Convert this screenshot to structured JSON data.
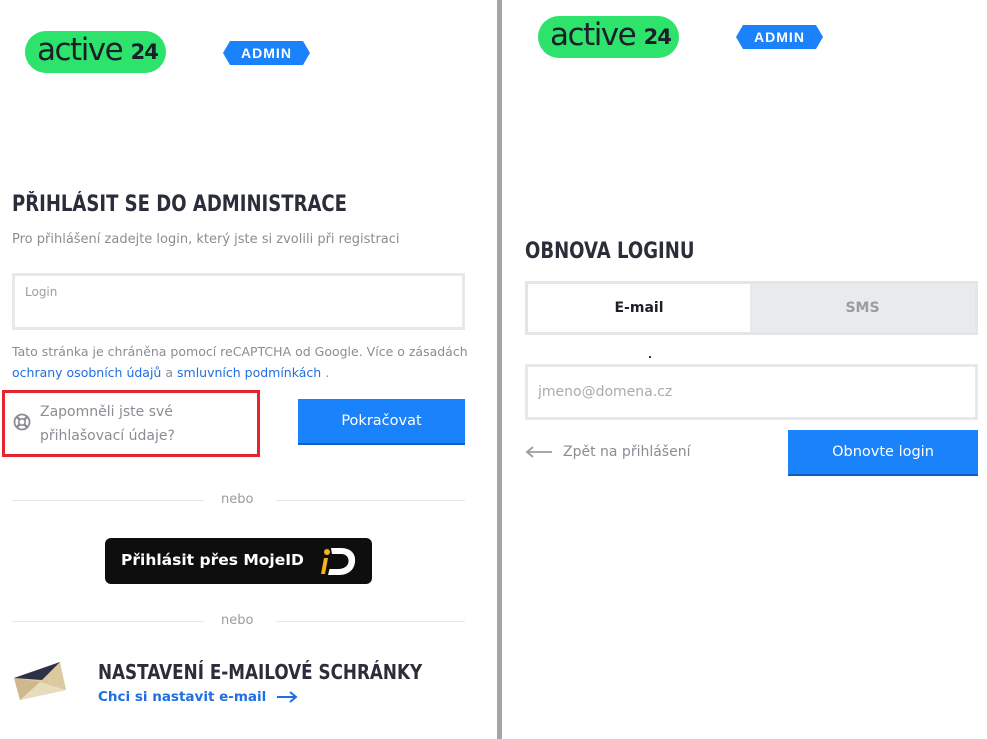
{
  "colors": {
    "brand_green": "#2de36b",
    "brand_blue": "#1a82fb",
    "highlight_red": "#e3262d",
    "link_blue": "#1f6fe0"
  },
  "brand": {
    "logo_word": "active",
    "logo_number": "24",
    "badge": "ADMIN"
  },
  "login_panel": {
    "title": "PŘIHLÁSIT SE DO ADMINISTRACE",
    "subtitle": "Pro přihlášení zadejte login, který jste si zvolili při registraci",
    "login_field": {
      "label": "Login",
      "value": ""
    },
    "recaptcha": {
      "text_before": "Tato stránka je chráněna pomocí reCAPTCHA od Google. Více o zásadách",
      "privacy_link": "ochrany osobních údajů",
      "conjunction": "a",
      "terms_link": "smluvních podmínkách",
      "text_after": "."
    },
    "forgot_icon": "lifebuoy-icon",
    "forgot_text": "Zapomněli jste své přihlašovací údaje?",
    "continue_button": "Pokračovat",
    "separator_1": "nebo",
    "mojeid_button": "Přihlásit přes MojeID",
    "mojeid_icon": "mojeid-logo-icon",
    "separator_2": "nebo",
    "email_setup": {
      "icon": "envelope-icon",
      "title": "NASTAVENÍ E-MAILOVÉ SCHRÁNKY",
      "link": "Chci si nastavit e-mail",
      "link_icon": "arrow-right-icon"
    }
  },
  "recovery_panel": {
    "title": "OBNOVA LOGINU",
    "tabs": [
      {
        "label": "E-mail",
        "active": true
      },
      {
        "label": "SMS",
        "active": false
      }
    ],
    "email_field": {
      "placeholder": "jmeno@domena.cz",
      "value": ""
    },
    "back_icon": "arrow-left-icon",
    "back_link": "Zpět na přihlášení",
    "submit_button": "Obnovte login"
  }
}
